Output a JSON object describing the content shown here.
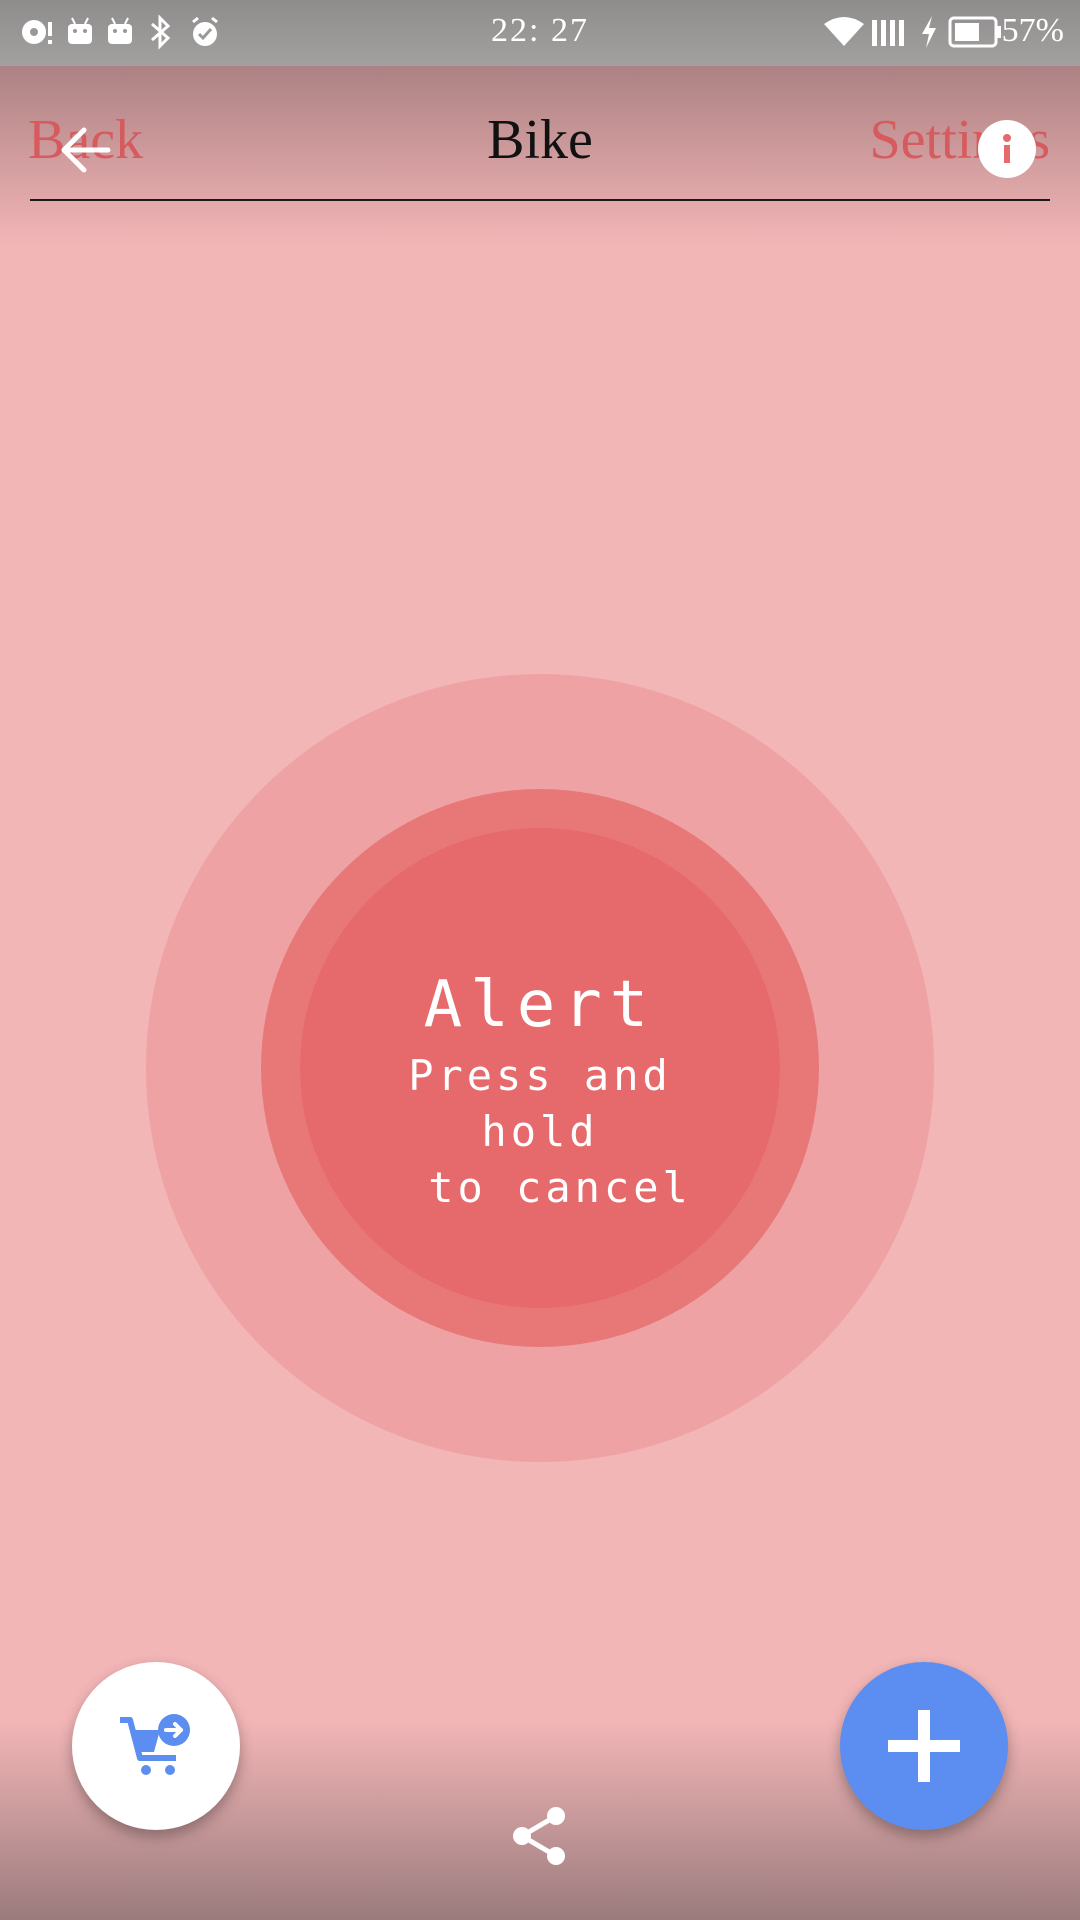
{
  "status_bar": {
    "time": "22: 27",
    "battery_percent": "57%",
    "left_icons": [
      "music-notification-icon",
      "android-notification-icon",
      "android-notification-icon",
      "bluetooth-icon",
      "alarm-icon"
    ],
    "right_icons": [
      "wifi-icon",
      "signal-icon",
      "charging-icon",
      "battery-icon"
    ]
  },
  "nav": {
    "back_label": "Back",
    "title": "Bike",
    "settings_label": "Settings",
    "back_icon": "arrow-left-icon",
    "info_icon": "info-icon"
  },
  "alert": {
    "title": "Alert",
    "subtitle_line1": "Press and hold",
    "subtitle_line2": "to cancel"
  },
  "fabs": {
    "cart_icon": "cart-arrow-icon",
    "add_icon": "plus-icon",
    "share_icon": "share-icon"
  },
  "colors": {
    "background": "#f3b6b7",
    "outer_ring": "#efa2a3",
    "middle_ring": "#e87878",
    "alert_fill": "#e66a6c",
    "accent_red": "#d65a5e",
    "fab_blue": "#5b8ef0"
  }
}
